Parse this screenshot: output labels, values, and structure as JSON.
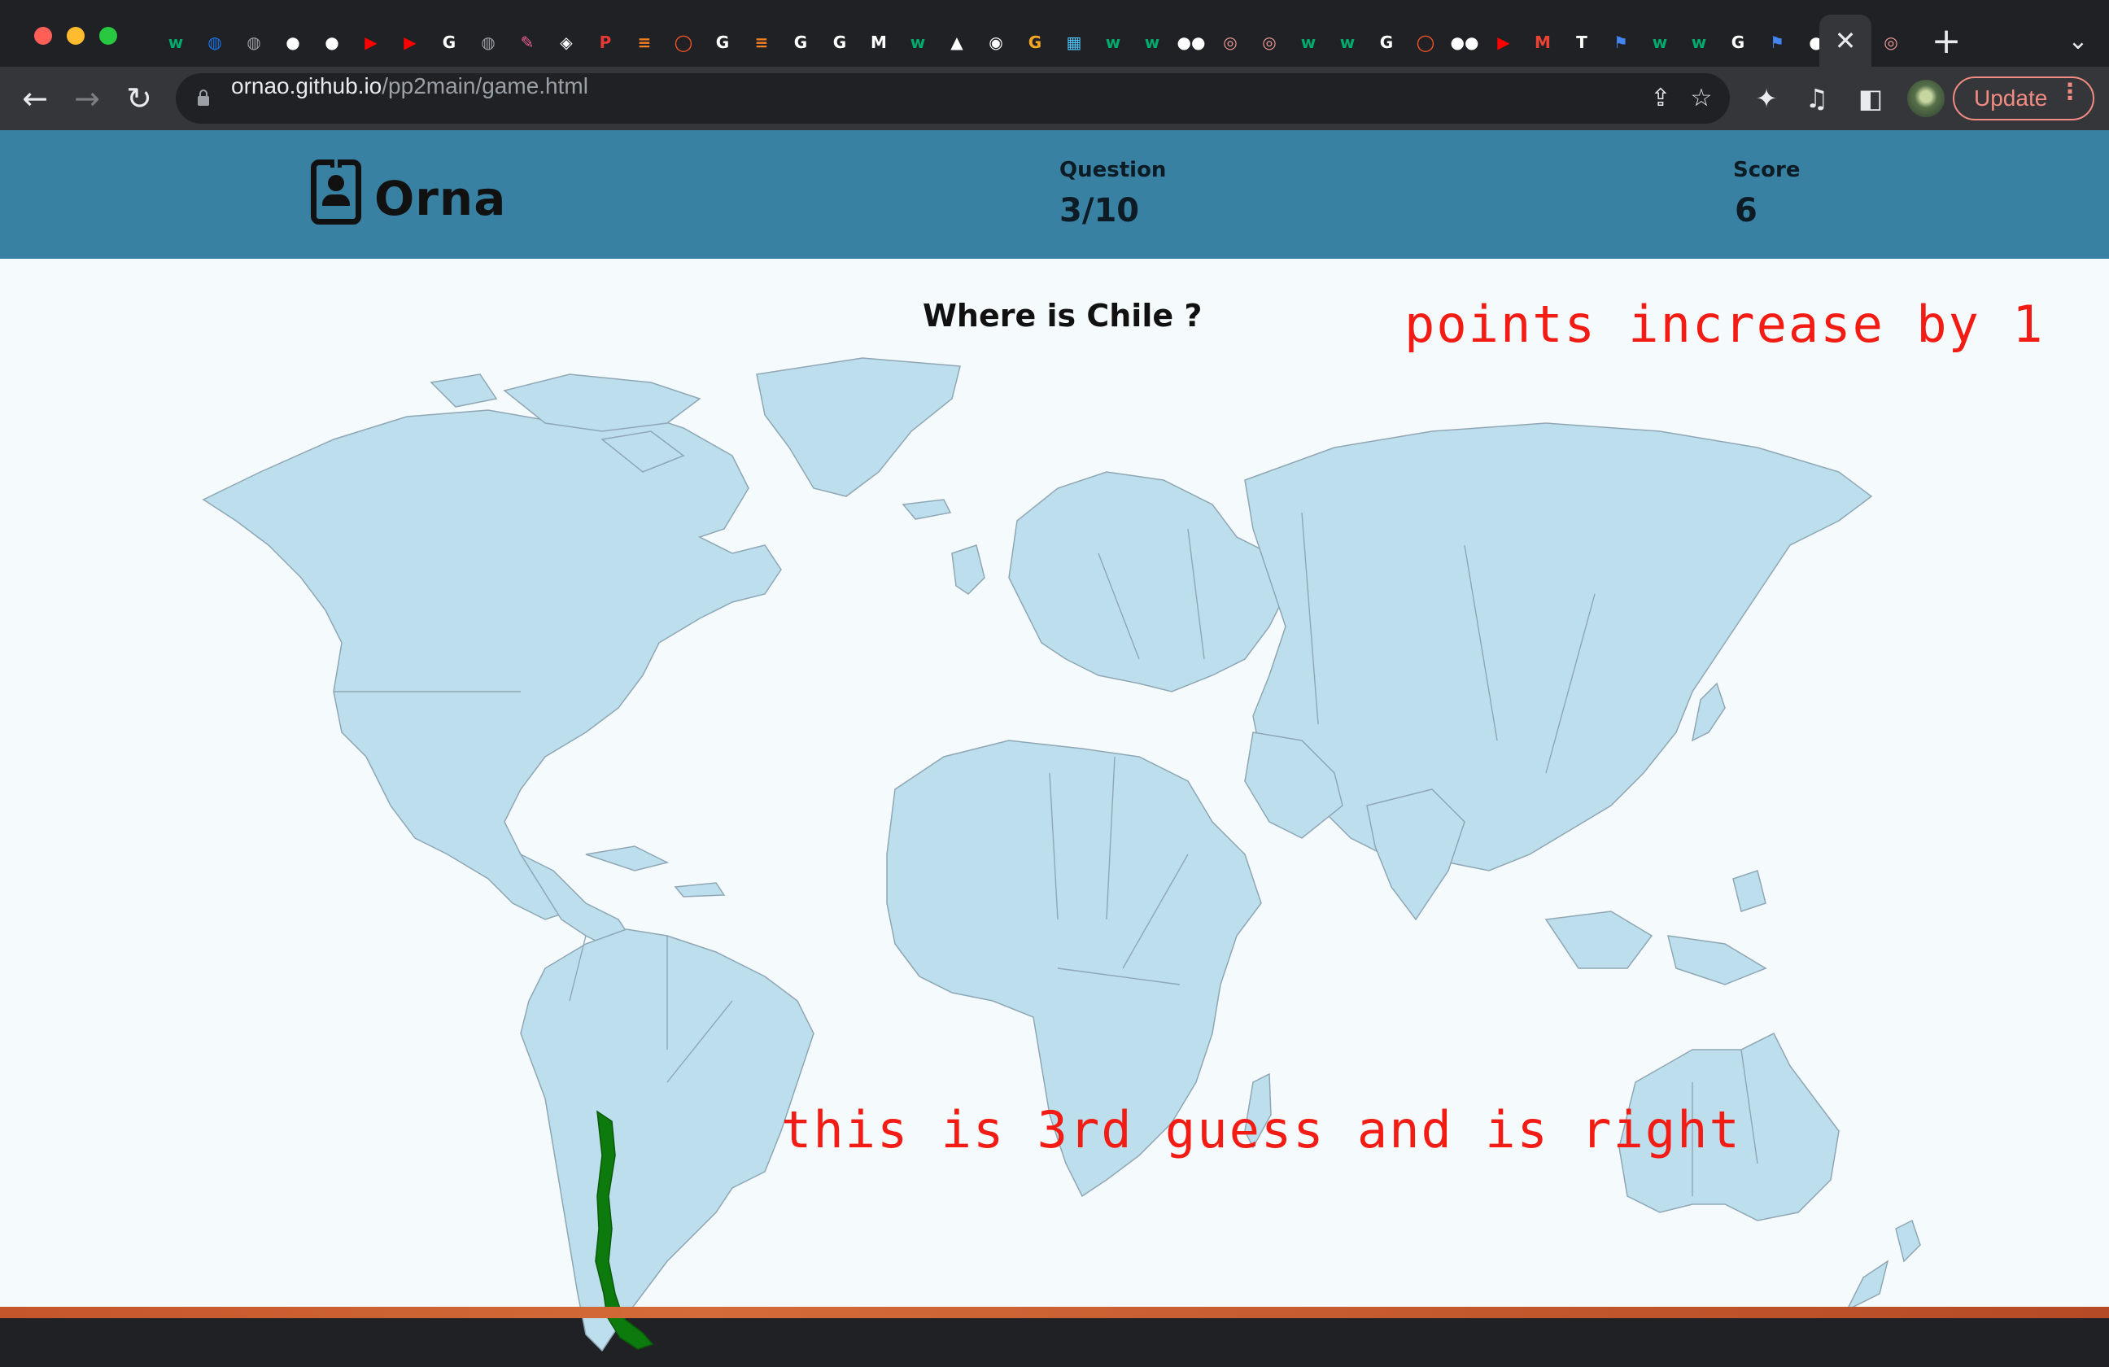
{
  "browser": {
    "tab_favicons": [
      {
        "icon": "w3schools-icon",
        "color": "#04aa6d",
        "glyph": "w"
      },
      {
        "icon": "globe-icon",
        "color": "#1a73e8",
        "glyph": "◍"
      },
      {
        "icon": "globe-icon",
        "color": "#9aa0a6",
        "glyph": "◍"
      },
      {
        "icon": "github-icon",
        "color": "#ffffff",
        "glyph": "●"
      },
      {
        "icon": "github-icon",
        "color": "#ffffff",
        "glyph": "●"
      },
      {
        "icon": "youtube-icon",
        "color": "#ff0000",
        "glyph": "▶"
      },
      {
        "icon": "youtube-icon",
        "color": "#ff0000",
        "glyph": "▶"
      },
      {
        "icon": "google-icon",
        "color": "#ffffff",
        "glyph": "G"
      },
      {
        "icon": "globe-icon",
        "color": "#9aa0a6",
        "glyph": "◍"
      },
      {
        "icon": "crayon-icon",
        "color": "#f06292",
        "glyph": "✎"
      },
      {
        "icon": "codepen-icon",
        "color": "#ffffff",
        "glyph": "◈"
      },
      {
        "icon": "p-icon",
        "color": "#e53935",
        "glyph": "P"
      },
      {
        "icon": "stackoverflow-icon",
        "color": "#f48024",
        "glyph": "≡"
      },
      {
        "icon": "ring-icon",
        "color": "#ff5722",
        "glyph": "◯"
      },
      {
        "icon": "google-icon",
        "color": "#ffffff",
        "glyph": "G"
      },
      {
        "icon": "stackoverflow-icon",
        "color": "#f48024",
        "glyph": "≡"
      },
      {
        "icon": "google-icon",
        "color": "#ffffff",
        "glyph": "G"
      },
      {
        "icon": "google-icon",
        "color": "#ffffff",
        "glyph": "G"
      },
      {
        "icon": "m-icon",
        "color": "#ffffff",
        "glyph": "M"
      },
      {
        "icon": "w3schools-icon",
        "color": "#04aa6d",
        "glyph": "w"
      },
      {
        "icon": "linux-icon",
        "color": "#ffffff",
        "glyph": "▲"
      },
      {
        "icon": "chrome-icon",
        "color": "#ffffff",
        "glyph": "◉"
      },
      {
        "icon": "g-icon",
        "color": "#f5a623",
        "glyph": "G"
      },
      {
        "icon": "map-icon",
        "color": "#4fc3f7",
        "glyph": "▦"
      },
      {
        "icon": "w3schools-icon",
        "color": "#04aa6d",
        "glyph": "w"
      },
      {
        "icon": "w3schools-icon",
        "color": "#04aa6d",
        "glyph": "w"
      },
      {
        "icon": "medium-icon",
        "color": "#ffffff",
        "glyph": "●●"
      },
      {
        "icon": "circle-icon",
        "color": "#ef9a9a",
        "glyph": "◎"
      },
      {
        "icon": "circle-icon",
        "color": "#ef9a9a",
        "glyph": "◎"
      },
      {
        "icon": "w3schools-icon",
        "color": "#04aa6d",
        "glyph": "w"
      },
      {
        "icon": "w3schools-icon",
        "color": "#04aa6d",
        "glyph": "w"
      },
      {
        "icon": "google-icon",
        "color": "#ffffff",
        "glyph": "G"
      },
      {
        "icon": "ring-icon",
        "color": "#ff5722",
        "glyph": "◯"
      },
      {
        "icon": "medium-icon",
        "color": "#ffffff",
        "glyph": "●●"
      },
      {
        "icon": "youtube-icon",
        "color": "#ff0000",
        "glyph": "▶"
      },
      {
        "icon": "gmail-icon",
        "color": "#ea4335",
        "glyph": "M"
      },
      {
        "icon": "t-icon",
        "color": "#ffffff",
        "glyph": "T"
      },
      {
        "icon": "flag-icon",
        "color": "#4285f4",
        "glyph": "⚑"
      },
      {
        "icon": "w3schools-icon",
        "color": "#04aa6d",
        "glyph": "w"
      },
      {
        "icon": "w3schools-icon",
        "color": "#04aa6d",
        "glyph": "w"
      },
      {
        "icon": "google-icon",
        "color": "#ffffff",
        "glyph": "G"
      },
      {
        "icon": "flag-icon",
        "color": "#4285f4",
        "glyph": "⚑"
      },
      {
        "icon": "github-icon",
        "color": "#ffffff",
        "glyph": "●"
      }
    ],
    "active_tab_close": "✕",
    "after_active_favicon": {
      "icon": "circle-icon",
      "color": "#ef9a9a",
      "glyph": "◎"
    },
    "new_tab": "+",
    "tab_menu": "⌄",
    "url_host": "ornao.github.io",
    "url_path": "/pp2main/game.html",
    "update_label": "Update"
  },
  "app": {
    "brand": "Orna",
    "question_label": "Question",
    "question_value": "3/10",
    "score_label": "Score",
    "score_value": "6",
    "prompt": "Where is Chile ?",
    "highlighted_country": "Chile",
    "highlight_color": "#0c7a0c",
    "land_color": "#bcdeed",
    "header_color": "#3981a2"
  },
  "annotations": {
    "top": "points increase by 1",
    "bottom": "this is 3rd guess and is right",
    "color": "#f21c14"
  }
}
